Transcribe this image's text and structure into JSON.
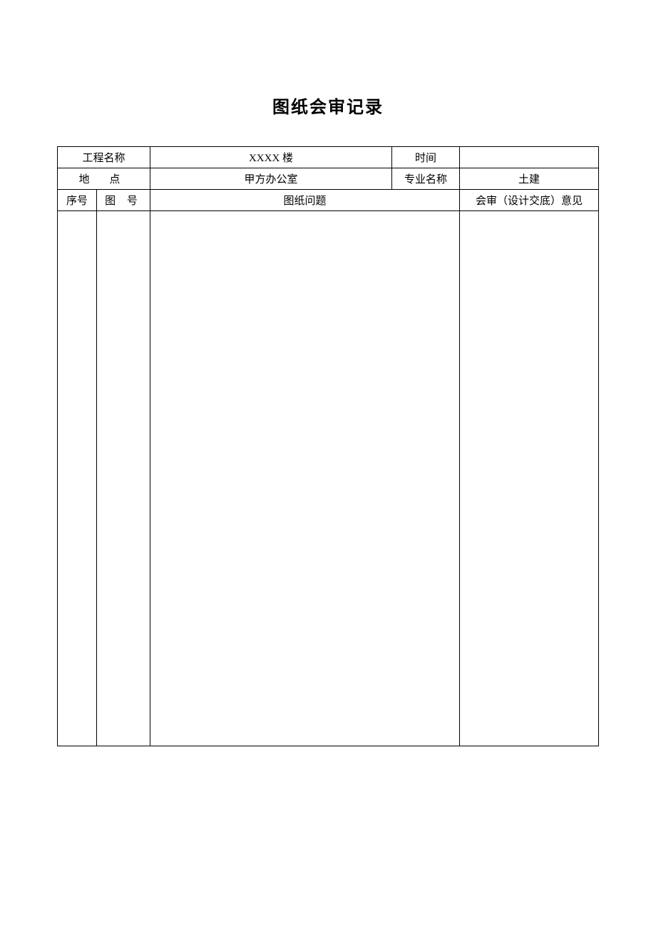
{
  "title": "图纸会审记录",
  "row1": {
    "project_name_label": "工程名称",
    "project_name_value": "XXXX 楼",
    "time_label": "时间",
    "time_value": ""
  },
  "row2": {
    "location_label": "地  点",
    "location_value": "甲方办公室",
    "specialty_label": "专业名称",
    "specialty_value": "土建"
  },
  "row3": {
    "seq_label": "序号",
    "drawing_no_label": "图 号",
    "drawing_issue_label": "图纸问题",
    "opinion_label": "会审（设计交底）意见"
  },
  "body": {
    "seq": "",
    "drawing_no": "",
    "drawing_issue": "",
    "opinion": ""
  }
}
